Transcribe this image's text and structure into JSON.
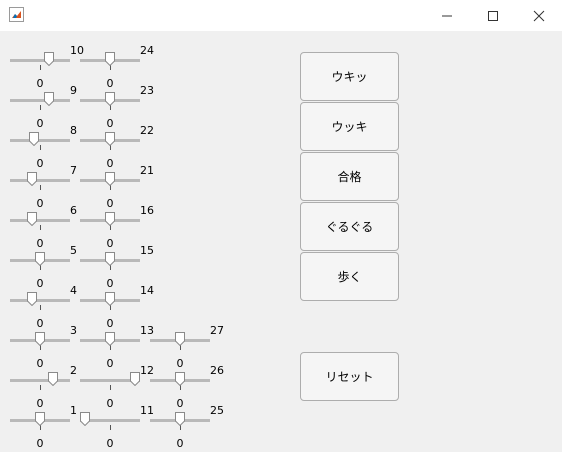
{
  "window": {
    "icon": "matlab-figure-icon",
    "controls": [
      "minimize-icon",
      "maximize-icon",
      "close-icon"
    ]
  },
  "sliders": [
    {
      "label": "10",
      "value": 0.67,
      "min_label": "0"
    },
    {
      "label": "9",
      "value": 0.67,
      "min_label": "0"
    },
    {
      "label": "8",
      "value": 0.38,
      "min_label": "0"
    },
    {
      "label": "7",
      "value": 0.33,
      "min_label": "0"
    },
    {
      "label": "6",
      "value": 0.33,
      "min_label": "0"
    },
    {
      "label": "5",
      "value": 0.5,
      "min_label": "0"
    },
    {
      "label": "4",
      "value": 0.33,
      "min_label": "0"
    },
    {
      "label": "3",
      "value": 0.5,
      "min_label": "0"
    },
    {
      "label": "2",
      "value": 0.75,
      "min_label": "0"
    },
    {
      "label": "1",
      "value": 0.5,
      "min_label": "0"
    },
    {
      "label": "24",
      "value": 0.5,
      "min_label": "0"
    },
    {
      "label": "23",
      "value": 0.5,
      "min_label": "0"
    },
    {
      "label": "22",
      "value": 0.5,
      "min_label": "0"
    },
    {
      "label": "21",
      "value": 0.5,
      "min_label": "0"
    },
    {
      "label": "16",
      "value": 0.5,
      "min_label": "0"
    },
    {
      "label": "15",
      "value": 0.5,
      "min_label": "0"
    },
    {
      "label": "14",
      "value": 0.5,
      "min_label": "0"
    },
    {
      "label": "13",
      "value": 0.5,
      "min_label": "0"
    },
    {
      "label": "12",
      "value": 1.0,
      "min_label": "0"
    },
    {
      "label": "11",
      "value": 0.0,
      "min_label": "0"
    },
    {
      "label": "27",
      "value": 0.5,
      "min_label": "0"
    },
    {
      "label": "26",
      "value": 0.5,
      "min_label": "0"
    },
    {
      "label": "25",
      "value": 0.5,
      "min_label": "0"
    }
  ],
  "buttons": [
    "ウキッ",
    "ウッキ",
    "合格",
    "ぐるぐる",
    "歩く",
    "リセット"
  ]
}
